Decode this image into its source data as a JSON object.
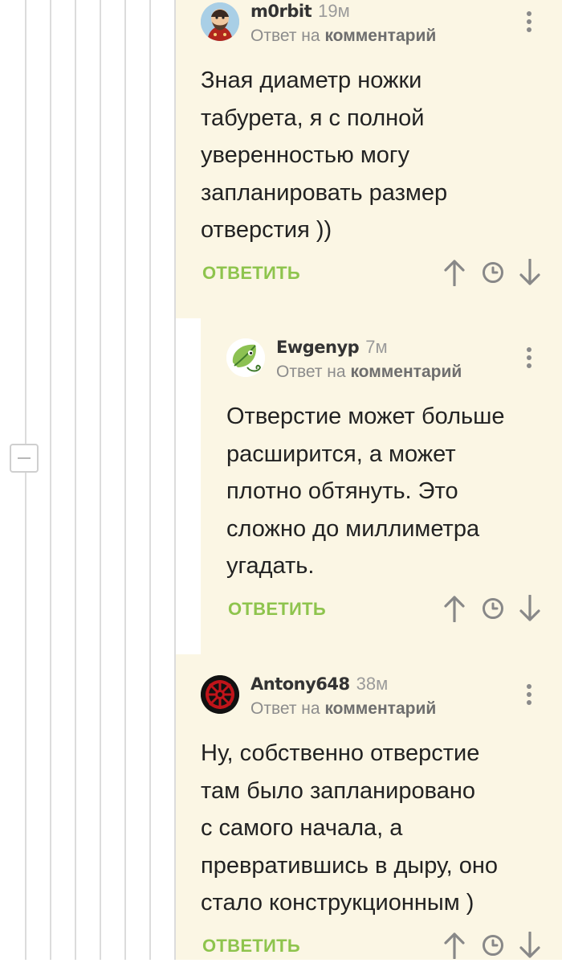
{
  "comments": [
    {
      "author": "m0rbit",
      "time": "19м",
      "reply_prefix": "Ответ на",
      "reply_target": "комментарий",
      "text": "Зная диаметр ножки\nтабурета, я с полной\nуверенностью могу\nзапланировать размер\nотверстия ))",
      "reply_label": "ОТВЕТИТЬ"
    },
    {
      "author": "Ewgenyp",
      "time": "7м",
      "reply_prefix": "Ответ на",
      "reply_target": "комментарий",
      "text": "Отверстие может больше\nрасширится, а может\nплотно обтянуть. Это\nсложно до миллиметра\nугадать.",
      "reply_label": "ОТВЕТИТЬ"
    },
    {
      "author": "Antony648",
      "time": "38м",
      "reply_prefix": "Ответ на",
      "reply_target": "комментарий",
      "text": "Ну, собственно отверстие\nтам было запланировано\nс самого начала, а\nпревратившись в дыру, оно\nстало конструкционным )",
      "reply_label": "ОТВЕТИТЬ"
    }
  ],
  "icons": {
    "upvote": "arrow-up-icon",
    "save": "clock-icon",
    "downvote": "arrow-down-icon",
    "more": "more-vertical-icon",
    "collapse": "minus-icon"
  },
  "colors": {
    "accent_green": "#8ec44d",
    "comment_bg": "#fbf6e4",
    "thread_line": "#dcdcdc"
  }
}
